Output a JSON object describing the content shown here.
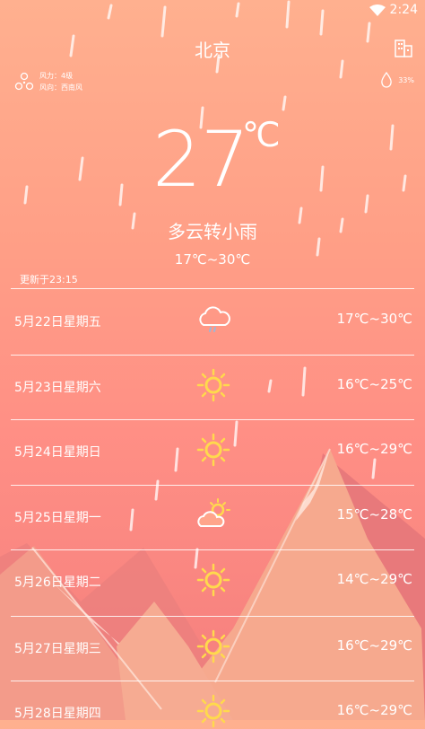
{
  "status": {
    "time": "2:24"
  },
  "city": "北京",
  "wind": {
    "force": "风力：4级",
    "direction": "风向：西南风"
  },
  "humidity": "33%",
  "current": {
    "temp": "27",
    "unit": "℃",
    "condition": "多云转小雨",
    "range": "17℃~30℃"
  },
  "update_time": "更新于23:15",
  "forecast": [
    {
      "date": "5月22日星期五",
      "icon": "cloud-rain-icon",
      "range": "17℃~30℃"
    },
    {
      "date": "5月23日星期六",
      "icon": "sun-icon",
      "range": "16℃~25℃"
    },
    {
      "date": "5月24日星期日",
      "icon": "sun-icon",
      "range": "16℃~29℃"
    },
    {
      "date": "5月25日星期一",
      "icon": "partly-cloudy-icon",
      "range": "15℃~28℃"
    },
    {
      "date": "5月26日星期二",
      "icon": "sun-icon",
      "range": "14℃~29℃"
    },
    {
      "date": "5月27日星期三",
      "icon": "sun-icon",
      "range": "16℃~29℃"
    },
    {
      "date": "5月28日星期四",
      "icon": "sun-icon",
      "range": "16℃~29℃"
    }
  ],
  "colors": {
    "sun": "#ffd94d",
    "mountain": "#f6a98e",
    "mountain_dark": "#ea7f7e",
    "snow": "#ffe9e0"
  }
}
